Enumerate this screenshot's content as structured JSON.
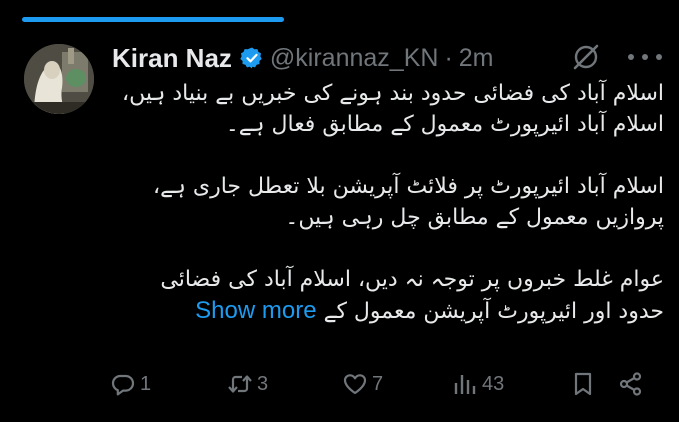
{
  "post": {
    "author_name": "Kiran Naz",
    "handle": "@kirannaz_KN",
    "separator": "·",
    "time": "2m",
    "body_paragraphs": [
      "اسلام آباد کی فضائی حدود بند ہونے کی خبریں بے بنیاد ہیں، اسلام آباد ائیرپورٹ معمول کے مطابق فعال ہے۔",
      "اسلام آباد ائیرپورٹ پر فلائٹ آپریشن بلا تعطل جاری ہے، پروازیں معمول کے مطابق چل رہی ہیں۔",
      "عوام غلط خبروں پر توجہ نہ دیں، اسلام آباد کی فضائی حدود اور ائیرپورٹ آپریشن معمول کے"
    ],
    "show_more": "Show more"
  },
  "actions": {
    "replies": "1",
    "reposts": "3",
    "likes": "7",
    "views": "43"
  },
  "media_progress": 0.4,
  "icons": [
    "verified-badge-icon",
    "grok-icon",
    "more-icon",
    "reply-icon",
    "repost-icon",
    "like-icon",
    "views-icon",
    "bookmark-icon",
    "share-icon"
  ],
  "colors": {
    "background": "#000000",
    "text": "#e7e9ea",
    "muted": "#71767b",
    "accent": "#1d9bf0"
  }
}
